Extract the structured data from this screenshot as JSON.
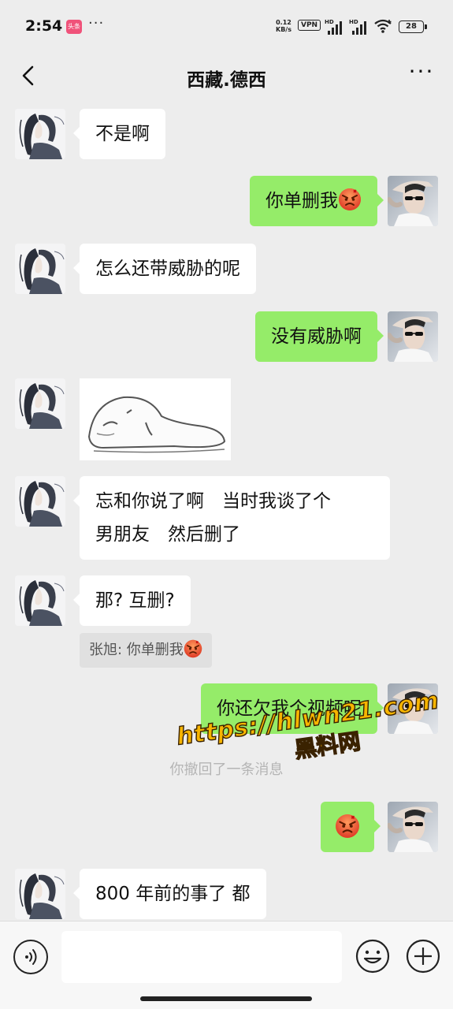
{
  "status_bar": {
    "time": "2:54",
    "app_badge": "头条",
    "more_dots": "···",
    "net_speed_value": "0.12",
    "net_speed_unit": "KB/s",
    "vpn": "VPN",
    "hd_label": "HD",
    "battery": "28"
  },
  "nav": {
    "title": "西藏.德西",
    "more": "···"
  },
  "messages": [
    {
      "side": "in",
      "text": "不是啊"
    },
    {
      "side": "out",
      "text": "你单删我",
      "emoji": "angry-face"
    },
    {
      "side": "in",
      "text": "怎么还带威胁的呢"
    },
    {
      "side": "out",
      "text": "没有威胁啊"
    },
    {
      "side": "in",
      "sticker": "lying-blob-sticker"
    },
    {
      "side": "in",
      "text_line1": "忘和你说了啊　当时我谈了个",
      "text_line2": "男朋友　然后删了"
    },
    {
      "side": "in",
      "text": "那? 互删?"
    },
    {
      "side": "out",
      "text": "你还欠我个视频呢"
    },
    {
      "side": "out",
      "emoji": "angry-face"
    },
    {
      "side": "in",
      "text": "800 年前的事了 都"
    }
  ],
  "quote": {
    "text": "张旭: 你单删我",
    "emoji": "angry-face"
  },
  "recall_notice": "你撤回了一条消息",
  "watermark": {
    "url": "https://hlwn21.com",
    "brand": "黑料网"
  },
  "input_bar": {
    "value": "",
    "placeholder": ""
  },
  "colors": {
    "background": "#ededed",
    "incoming_bubble": "#ffffff",
    "outgoing_bubble": "#95ec69",
    "watermark": "#f7b500"
  }
}
